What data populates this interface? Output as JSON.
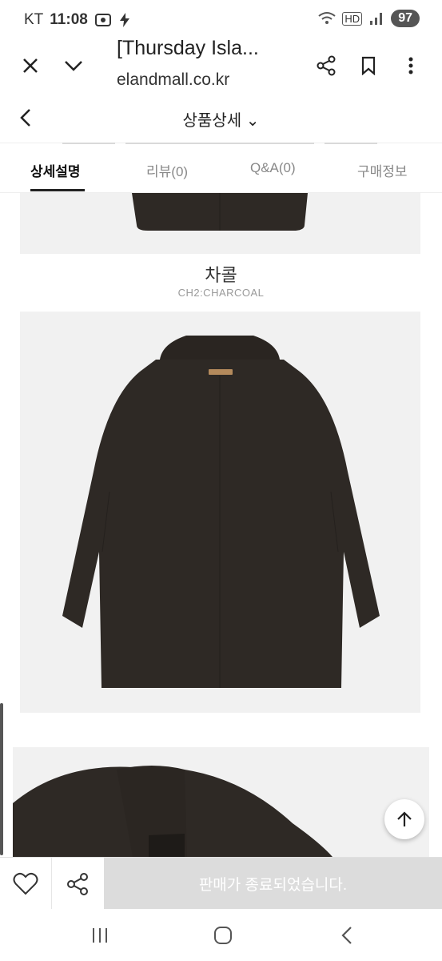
{
  "status": {
    "carrier": "KT",
    "time": "11:08",
    "hd": "HD",
    "battery": "97"
  },
  "browser": {
    "title": "[Thursday Isla...",
    "url": "elandmall.co.kr",
    "close_icon": "close-icon",
    "chevron_icon": "chevron-down-icon",
    "share_icon": "share-icon",
    "bookmark_icon": "bookmark-icon",
    "menu_icon": "more-vertical-icon"
  },
  "page_header": {
    "title": "상품상세 ⌄"
  },
  "tabs": [
    {
      "label": "상세설명",
      "active": true
    },
    {
      "label": "리뷰(0)"
    },
    {
      "label": "Q&A(0)"
    },
    {
      "label": "구매정보"
    }
  ],
  "product": {
    "color_name_kr": "차콜",
    "color_code": "CH2:CHARCOAL",
    "coat_color": "#2e2925"
  },
  "actions": {
    "sold_out_label": "판매가 종료되었습니다."
  },
  "colors": {
    "sold_bg": "#dcdcdc",
    "panel_bg": "#f1f1f1"
  }
}
